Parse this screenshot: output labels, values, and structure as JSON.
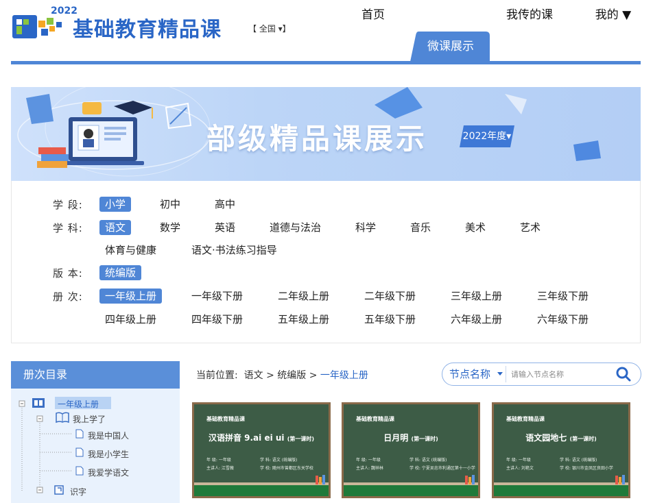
{
  "header": {
    "logo_year": "2022",
    "site_title": "基础教育精品课",
    "region": "【 全国 ▾】",
    "nav": [
      {
        "label": "首页"
      },
      {
        "label": "微课展示",
        "active": true
      },
      {
        "label": "我传的课"
      },
      {
        "label": "我的 ▼"
      }
    ]
  },
  "banner": {
    "title": "部级精品课展示",
    "year": "2022年度▾"
  },
  "filters": {
    "stage": {
      "label": "学 段:",
      "options": [
        "小学",
        "初中",
        "高中"
      ],
      "selected": "小学"
    },
    "subject": {
      "label": "学 科:",
      "options": [
        "语文",
        "数学",
        "英语",
        "道德与法治",
        "科学",
        "音乐",
        "美术",
        "艺术",
        "体育与健康",
        "语文·书法练习指导"
      ],
      "selected": "语文"
    },
    "edition": {
      "label": "版 本:",
      "options": [
        "统编版"
      ],
      "selected": "统编版"
    },
    "volume": {
      "label": "册 次:",
      "options": [
        "一年级上册",
        "一年级下册",
        "二年级上册",
        "二年级下册",
        "三年级上册",
        "三年级下册",
        "四年级上册",
        "四年级下册",
        "五年级上册",
        "五年级下册",
        "六年级上册",
        "六年级下册"
      ],
      "selected": "一年级上册"
    }
  },
  "sidebar": {
    "title": "册次目录",
    "tree": [
      {
        "label": "一年级上册",
        "level": 0
      },
      {
        "label": "我上学了",
        "level": 1
      },
      {
        "label": "我是中国人",
        "level": 2
      },
      {
        "label": "我是小学生",
        "level": 2
      },
      {
        "label": "我爱学语文",
        "level": 2
      },
      {
        "label": "识字",
        "level": 1
      }
    ]
  },
  "breadcrumb": {
    "prefix": "当前位置:",
    "items": [
      "语文",
      "统编版",
      "一年级上册"
    ],
    "sep": ">"
  },
  "search": {
    "type": "节点名称",
    "placeholder": "请输入节点名称"
  },
  "cards": [
    {
      "brand": "基础教育精品课",
      "title": "汉语拼音 9.ai ei ui",
      "sub": "(第一课时)",
      "grade": "年  级: 一年级",
      "subject": "学  科: 语文 (统编版)",
      "teacher": "主讲人: 江雪薇",
      "school": "学  校: 随州市曾都区东关学校"
    },
    {
      "brand": "基础教育精品课",
      "title": "日月明",
      "sub": "(第一课时)",
      "grade": "年  级: 一年级",
      "subject": "学  科: 语文 (统编版)",
      "teacher": "主讲人: 魏祥林",
      "school": "学  校: 宁夏吴忠市利通区第十一小学"
    },
    {
      "brand": "基础教育精品课",
      "title": "语文园地七",
      "sub": "(第一课时)",
      "grade": "年  级: 一年级",
      "subject": "学  科: 语文 (统编版)",
      "teacher": "主讲人: 刘艳文",
      "school": "学  校: 银川市金凤区良田小学"
    }
  ],
  "colors": {
    "primary": "#4f86d6",
    "title": "#2a66c6",
    "board": "#3d5c46"
  }
}
